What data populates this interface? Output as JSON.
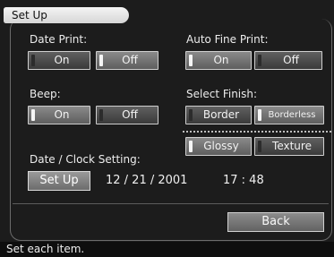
{
  "title": "Set Up",
  "date_print": {
    "label": "Date Print:",
    "options": [
      "On",
      "Off"
    ],
    "selected": "Off"
  },
  "auto_fine_print": {
    "label": "Auto Fine Print:",
    "options": [
      "On",
      "Off"
    ],
    "selected": "On"
  },
  "beep": {
    "label": "Beep:",
    "options": [
      "On",
      "Off"
    ],
    "selected": "On"
  },
  "select_finish": {
    "label": "Select Finish:",
    "border_options": [
      "Border",
      "Borderless"
    ],
    "border_selected": "Borderless",
    "surface_options": [
      "Glossy",
      "Texture"
    ],
    "surface_selected": "Glossy"
  },
  "date_clock": {
    "label": "Date / Clock Setting:",
    "button": "Set Up",
    "date": "12 / 21 / 2001",
    "time": "17 : 48"
  },
  "back_label": "Back",
  "status": "Set each item."
}
